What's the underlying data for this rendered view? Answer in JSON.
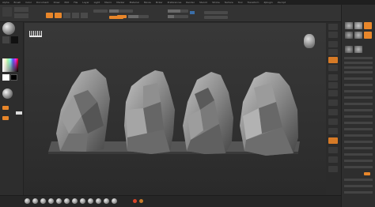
{
  "menubar": {
    "items": [
      "Alpha",
      "Brush",
      "Color",
      "Document",
      "Draw",
      "Edit",
      "File",
      "Layer",
      "Light",
      "Macro",
      "Marker",
      "Material",
      "Movie",
      "Picker",
      "Preferences",
      "Render",
      "Stencil",
      "Stroke",
      "Texture",
      "Tool",
      "Transform",
      "Zplugin",
      "Zscript"
    ]
  },
  "colors": {
    "accent": "#e8862a",
    "bg": "#2b2b2b",
    "panel": "#333333"
  },
  "canvas": {
    "rock_count": 4
  }
}
